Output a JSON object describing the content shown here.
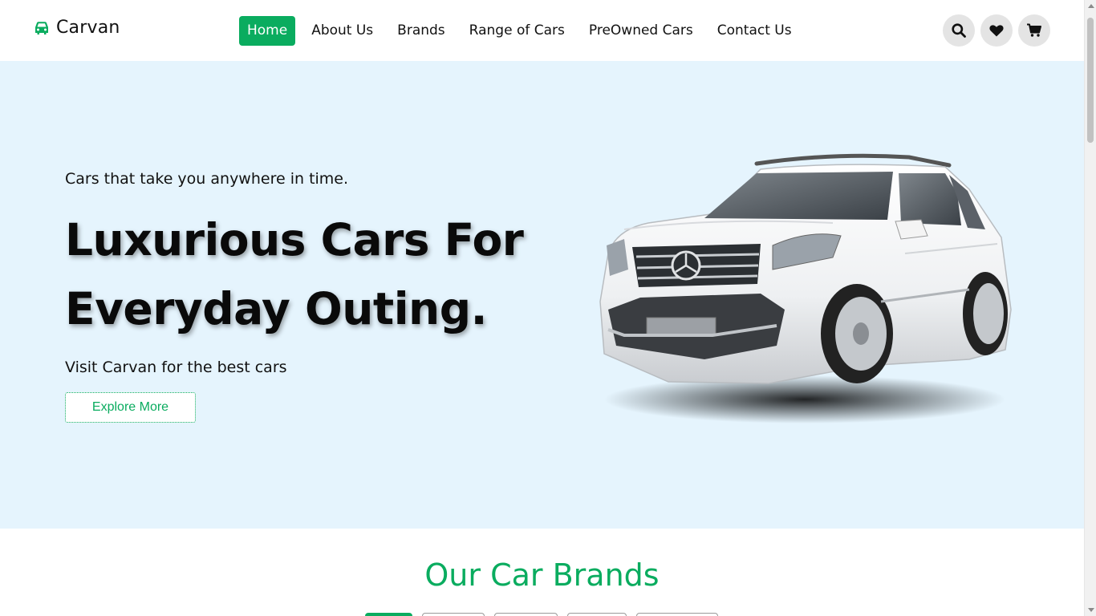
{
  "brand": {
    "name": "Carvan",
    "icon": "car-icon",
    "accent_color": "#0aac5f"
  },
  "nav": {
    "items": [
      {
        "label": "Home",
        "active": true
      },
      {
        "label": "About Us",
        "active": false
      },
      {
        "label": "Brands",
        "active": false
      },
      {
        "label": "Range of Cars",
        "active": false
      },
      {
        "label": "PreOwned Cars",
        "active": false
      },
      {
        "label": "Contact Us",
        "active": false
      }
    ]
  },
  "actions": [
    {
      "icon": "search-icon"
    },
    {
      "icon": "heart-icon"
    },
    {
      "icon": "cart-icon"
    }
  ],
  "hero": {
    "tagline": "Cars that take you anywhere in time.",
    "headline_line1": "Luxurious Cars For",
    "headline_line2": "Everyday Outing.",
    "subline": "Visit Carvan for the best cars",
    "cta_label": "Explore More",
    "background_color": "#e5f4fd",
    "image": "white-suv-car-image"
  },
  "brands_section": {
    "title": "Our Car Brands",
    "tabs_visible": 5
  }
}
